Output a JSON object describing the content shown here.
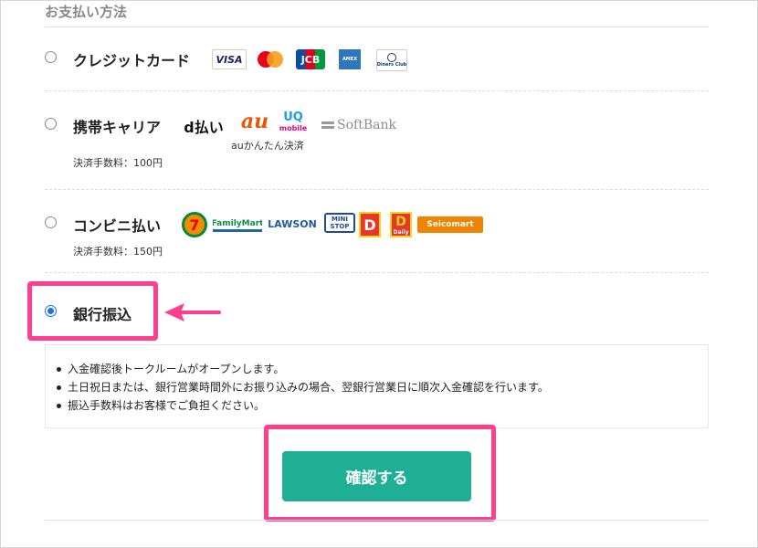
{
  "section_title": "お支払い方法",
  "methods": {
    "credit": {
      "label": "クレジットカード",
      "brands": [
        "VISA",
        "JCB",
        "AMEX",
        "Diners Club"
      ]
    },
    "carrier": {
      "label": "携帯キャリア",
      "fee": "決済手数料：100円",
      "brands": [
        "d払い",
        "au",
        "UQ",
        "mobile",
        "SoftBank"
      ],
      "au_caption": "auかんたん決済"
    },
    "convenience": {
      "label": "コンビニ払い",
      "fee": "決済手数料：150円",
      "brands": [
        "7",
        "FamilyMart",
        "LAWSON",
        "MINI STOP",
        "Daily",
        "Seicomart"
      ]
    },
    "bank": {
      "label": "銀行振込",
      "notes": [
        "入金確認後トークルームがオープンします。",
        "土日祝日または、銀行営業時間外にお振り込みの場合、翌銀行営業日に順次入金確認を行います。",
        "振込手数料はお客様でご負担ください。"
      ]
    }
  },
  "confirm_label": "確認する",
  "colors": {
    "highlight": "#ff3f8e",
    "confirm": "#1fae96",
    "radio_checked": "#1a73e8"
  }
}
